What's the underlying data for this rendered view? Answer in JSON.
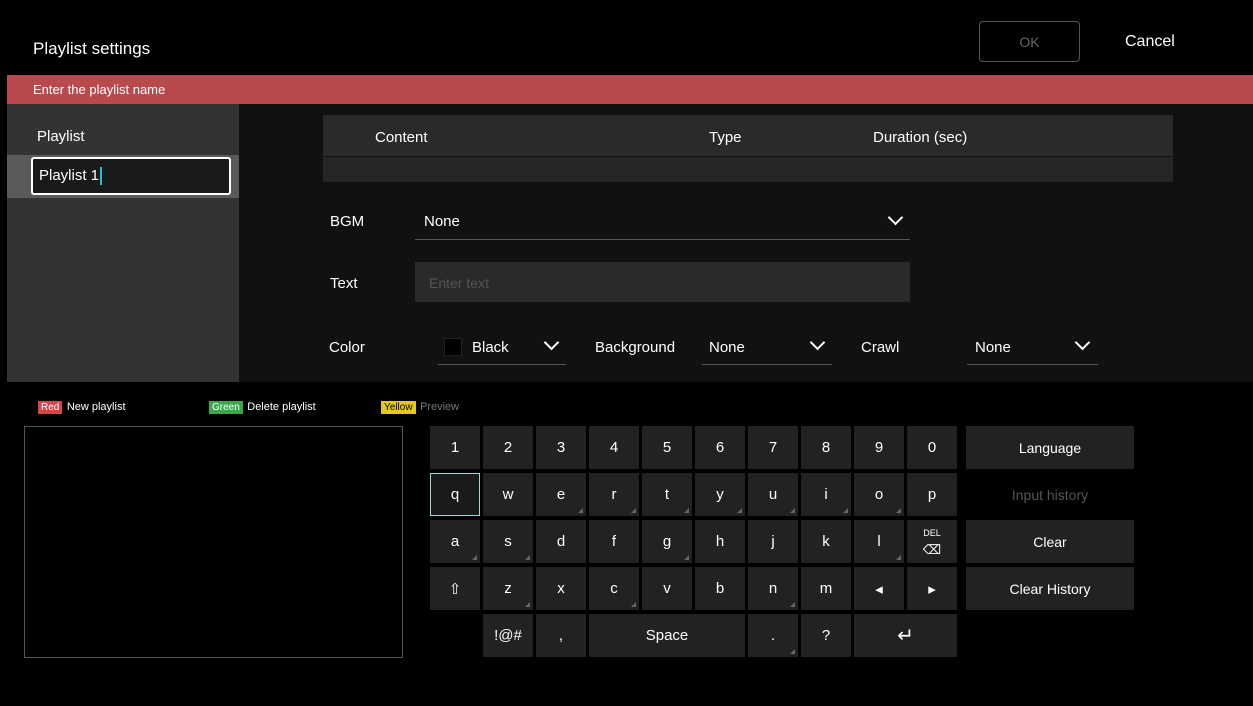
{
  "header": {
    "title": "Playlist settings",
    "ok_label": "OK",
    "cancel_label": "Cancel"
  },
  "banner": {
    "text": "Enter the playlist name"
  },
  "playlist": {
    "label": "Playlist",
    "name_value": "Playlist 1"
  },
  "table": {
    "columns": [
      "Content",
      "Type",
      "Duration (sec)"
    ]
  },
  "form": {
    "bgm_label": "BGM",
    "bgm_value": "None",
    "text_label": "Text",
    "text_placeholder": "Enter text",
    "color_label": "Color",
    "color_value": "Black",
    "color_swatch": "#000000",
    "background_label": "Background",
    "background_value": "None",
    "crawl_label": "Crawl",
    "crawl_value": "None"
  },
  "legend": [
    {
      "tag": "Red",
      "label": "New playlist",
      "color": "#d9444a"
    },
    {
      "tag": "Green",
      "label": "Delete playlist",
      "color": "#3aa84a"
    },
    {
      "tag": "Yellow",
      "label": "Preview",
      "color": "#e5c71e"
    }
  ],
  "keyboard": {
    "row1": [
      "1",
      "2",
      "3",
      "4",
      "5",
      "6",
      "7",
      "8",
      "9",
      "0"
    ],
    "row2": [
      "q",
      "w",
      "e",
      "r",
      "t",
      "y",
      "u",
      "i",
      "o",
      "p"
    ],
    "row3": [
      "a",
      "s",
      "d",
      "f",
      "g",
      "h",
      "j",
      "k",
      "l"
    ],
    "row4": [
      "⇧",
      "z",
      "x",
      "c",
      "v",
      "b",
      "n",
      "m",
      "◂",
      "▸"
    ],
    "del_label": "DEL",
    "symbols_label": "!@#",
    "comma_label": ",",
    "space_label": "Space",
    "period_label": ".",
    "question_label": "?",
    "enter_label": "↵",
    "side": {
      "language": "Language",
      "input_history": "Input history",
      "clear": "Clear",
      "clear_history": "Clear History"
    }
  },
  "colors": {
    "banner": "#b84a4e",
    "focus": "#9fd8dc",
    "caret": "#27c0c6"
  }
}
